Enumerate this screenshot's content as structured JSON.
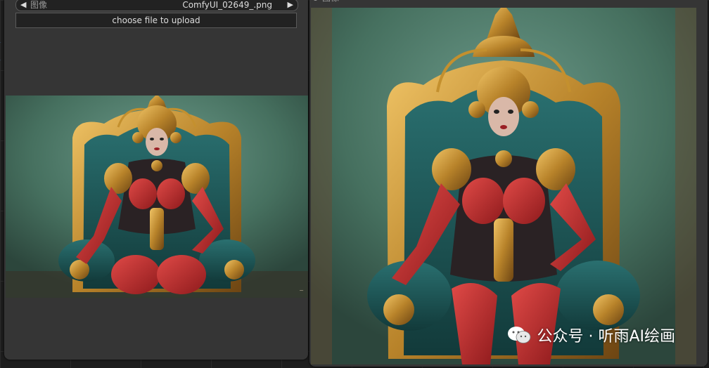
{
  "left_node": {
    "combo": {
      "left_arrow": "◀",
      "label": "图像",
      "value": "ComfyUI_02649_.png",
      "right_arrow": "▶"
    },
    "upload_button_label": "choose file to upload"
  },
  "right_node": {
    "title": "图像"
  },
  "watermark": {
    "text": "公众号 · 听雨AI绘画"
  },
  "colors": {
    "node_bg": "#353535",
    "canvas_bg": "#1d1d1d",
    "wall_teal": "#4e7a6d",
    "armor_red": "#c22b2e",
    "gold": "#c4902e",
    "chair_teal": "#1f5a5a",
    "link_blue": "#4b8cd6"
  },
  "icons": {
    "prev": "arrow-left-icon",
    "next": "arrow-right-icon",
    "wechat": "wechat-icon"
  }
}
